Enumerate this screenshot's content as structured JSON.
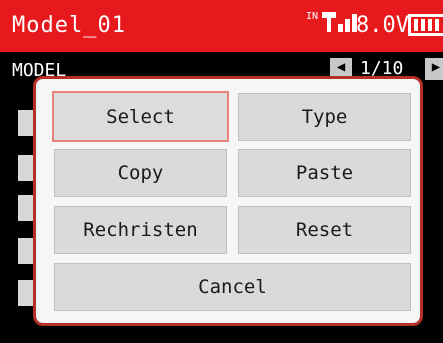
{
  "status_bar": {
    "model_name": "Model_01",
    "signal_label": "IN",
    "voltage": "8.0V"
  },
  "sub_bar": {
    "label": "MODEL",
    "page": "1/10"
  },
  "dialog": {
    "buttons": {
      "select": "Select",
      "type": "Type",
      "copy": "Copy",
      "paste": "Paste",
      "rechristen": "Rechristen",
      "reset": "Reset",
      "cancel": "Cancel"
    }
  },
  "colors": {
    "accent_red": "#e8191c",
    "dialog_border": "#b23027",
    "selected_outline": "#e8827c"
  },
  "icons": {
    "signal": "antenna-signal-icon",
    "battery": "battery-icon",
    "prev": "arrow-left-icon",
    "next": "arrow-right-icon"
  }
}
